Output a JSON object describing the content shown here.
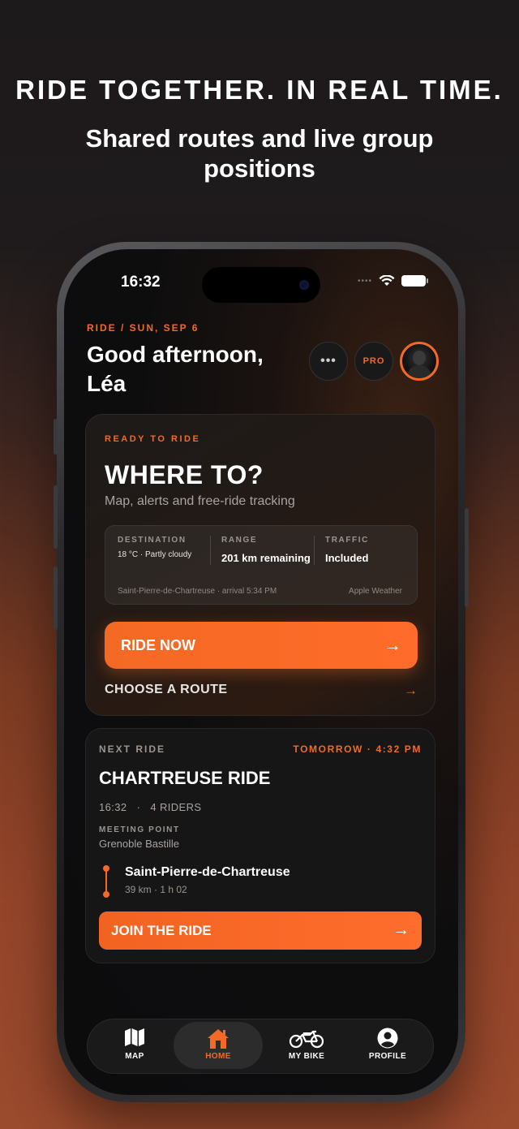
{
  "promo": {
    "headline": "RIDE TOGETHER. IN REAL TIME.",
    "subline": "Shared routes and live group positions"
  },
  "status_bar": {
    "time": "16:32"
  },
  "header": {
    "kicker": "RIDE / SUN, SEP 6",
    "greeting": "Good afternoon, Léa",
    "more_label": "•••",
    "pro_label": "PRO"
  },
  "ride_card": {
    "kicker": "READY TO RIDE",
    "title": "WHERE TO?",
    "subtitle": "Map, alerts and free-ride tracking",
    "info": {
      "destination_label": "DESTINATION",
      "destination_value": "18 °C · Partly cloudy",
      "range_label": "RANGE",
      "range_value": "201 km remaining",
      "traffic_label": "TRAFFIC",
      "traffic_value": "Included",
      "footer_left": "Saint-Pierre-de-Chartreuse · arrival 5:34 PM",
      "footer_right": " Apple Weather"
    },
    "ride_now_label": "RIDE NOW",
    "choose_route_label": "CHOOSE A ROUTE"
  },
  "next_ride": {
    "kicker": "NEXT RIDE",
    "when": "TOMORROW · 4:32 PM",
    "title": "CHARTREUSE RIDE",
    "meta": "16:32   ·   4 RIDERS",
    "meeting_label": "MEETING POINT",
    "meeting_value": "Grenoble Bastille",
    "destination": "Saint-Pierre-de-Chartreuse",
    "destination_meta": "39 km · 1 h 02",
    "join_label": "JOIN THE RIDE"
  },
  "tabs": [
    {
      "label": "MAP",
      "icon": "map-icon",
      "active": false
    },
    {
      "label": "HOME",
      "icon": "home-icon",
      "active": true
    },
    {
      "label": "MY BIKE",
      "icon": "motorcycle-icon",
      "active": false
    },
    {
      "label": "PROFILE",
      "icon": "profile-icon",
      "active": false
    }
  ],
  "colors": {
    "accent": "#f26a25",
    "background_dark": "#0c0c0d",
    "promo_bottom": "#9a4a2d"
  }
}
